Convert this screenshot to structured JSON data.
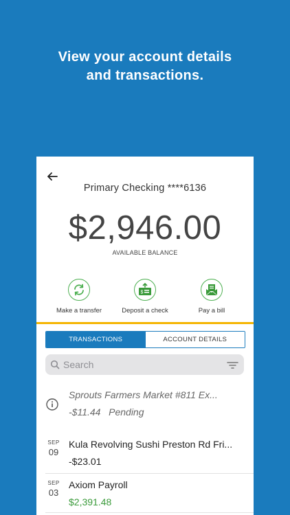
{
  "headline": {
    "line1": "View your account details",
    "line2": "and transactions."
  },
  "account": {
    "title": "Primary Checking ****6136",
    "balance": "$2,946.00",
    "balance_label": "AVAILABLE BALANCE"
  },
  "actions": [
    {
      "label": "Make a transfer",
      "icon": "transfer-icon"
    },
    {
      "label": "Deposit a check",
      "icon": "deposit-check-icon"
    },
    {
      "label": "Pay a bill",
      "icon": "pay-bill-icon"
    }
  ],
  "tabs": {
    "transactions": "TRANSACTIONS",
    "account_details": "ACCOUNT DETAILS"
  },
  "search": {
    "placeholder": "Search"
  },
  "transactions": [
    {
      "month": "",
      "day": "",
      "name": "Sprouts Farmers Market #811 Ex...",
      "amount": "-$11.44",
      "status": "Pending"
    },
    {
      "month": "SEP",
      "day": "09",
      "name": "Kula Revolving Sushi Preston Rd Fri...",
      "amount": "-$23.01",
      "status": ""
    },
    {
      "month": "SEP",
      "day": "03",
      "name": "Axiom Payroll",
      "amount": "$2,391.48",
      "status": ""
    }
  ],
  "colors": {
    "background": "#1a7bbd",
    "accent_green": "#4caf50",
    "divider_yellow": "#f5b400",
    "deposit_green": "#3a9a3a"
  }
}
